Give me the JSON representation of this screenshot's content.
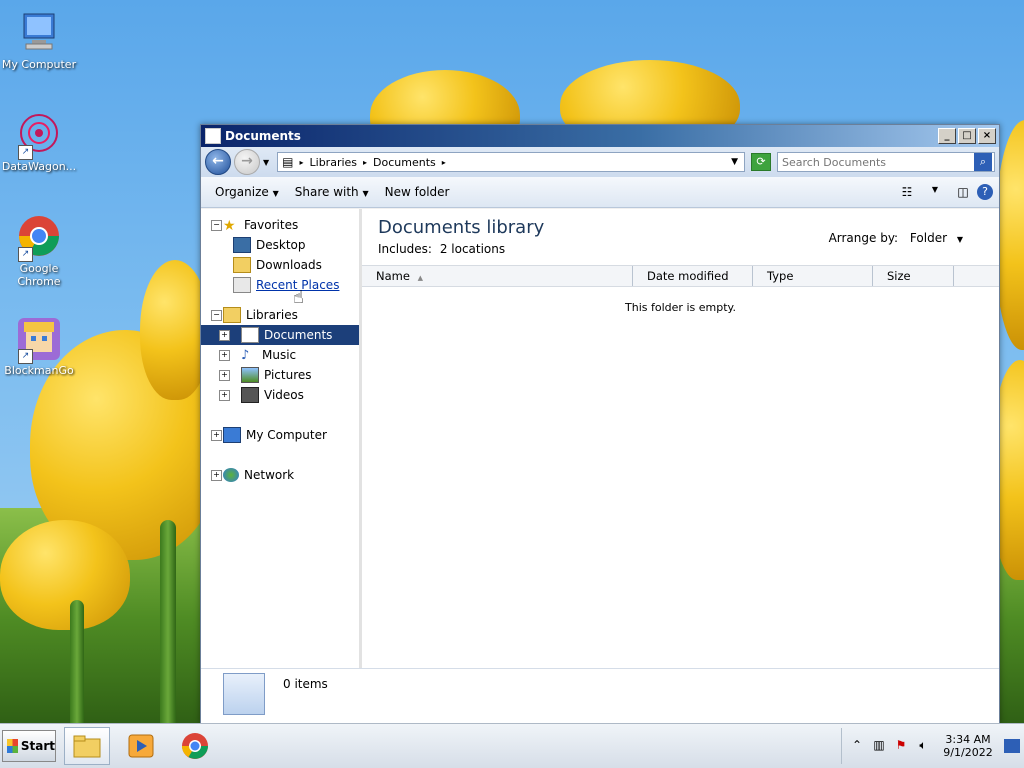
{
  "desktop": {
    "icons": [
      {
        "label": "My Computer"
      },
      {
        "label": "DataWagon..."
      },
      {
        "label": "Google Chrome"
      },
      {
        "label": "BlockmanGo"
      }
    ]
  },
  "window": {
    "title": "Documents",
    "controls": {
      "minimize": "_",
      "maximize": "□",
      "close": "×"
    },
    "address": {
      "crumbs": [
        "Libraries",
        "Documents"
      ]
    },
    "search": {
      "placeholder": "Search Documents"
    },
    "toolbar": {
      "organize": "Organize",
      "share_with": "Share with",
      "new_folder": "New folder"
    },
    "nav": {
      "favorites": "Favorites",
      "desktop": "Desktop",
      "downloads": "Downloads",
      "recent_places": "Recent Places",
      "libraries": "Libraries",
      "documents": "Documents",
      "music": "Music",
      "pictures": "Pictures",
      "videos": "Videos",
      "my_computer": "My Computer",
      "network": "Network"
    },
    "content": {
      "title": "Documents library",
      "includes_label": "Includes:",
      "includes_value": "2 locations",
      "arrange_by_label": "Arrange by:",
      "arrange_by_value": "Folder",
      "columns": [
        "Name",
        "Date modified",
        "Type",
        "Size"
      ],
      "empty_message": "This folder is empty."
    },
    "details": {
      "count": "0 items"
    }
  },
  "taskbar": {
    "start_label": "Start",
    "clock_time": "3:34 AM",
    "clock_date": "9/1/2022"
  }
}
